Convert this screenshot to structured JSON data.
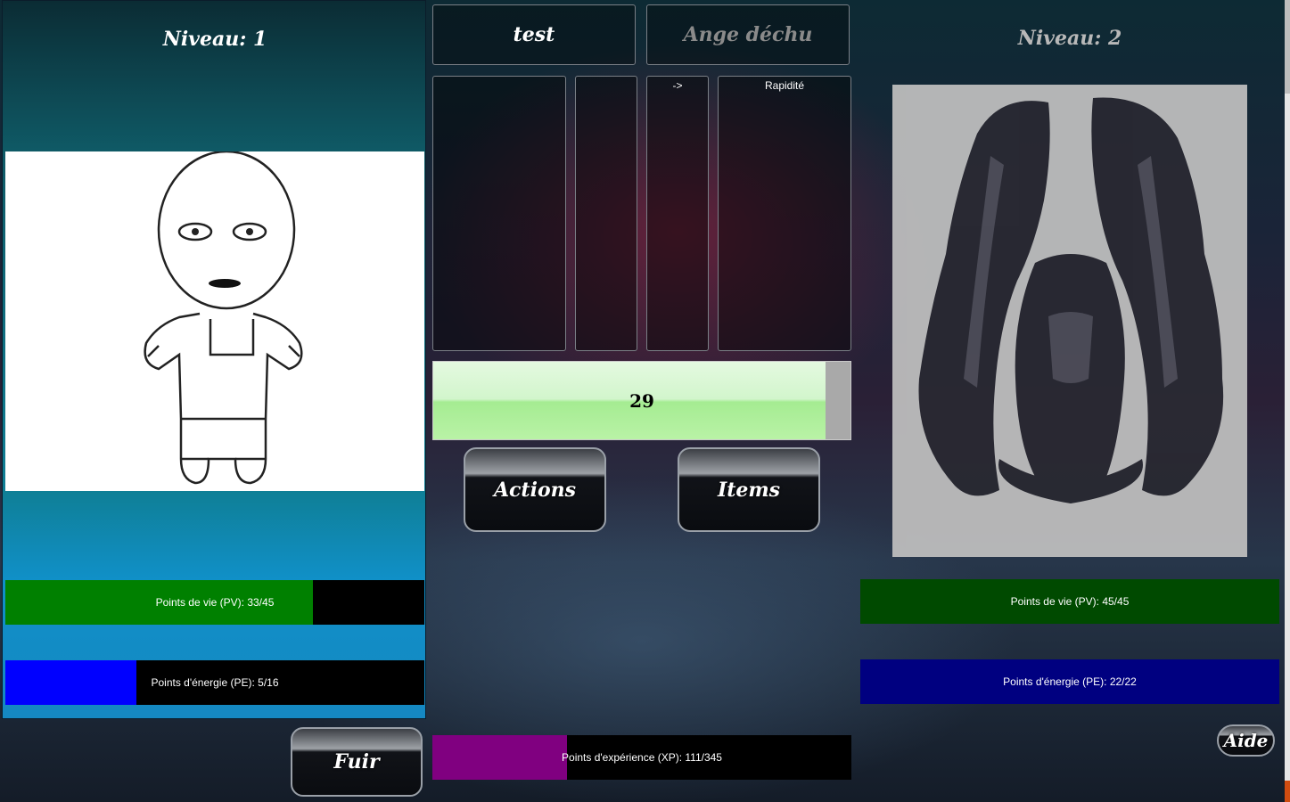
{
  "player": {
    "level_label": "Niveau: 1",
    "hp": {
      "label": "Points de vie (PV): 33/45",
      "current": 33,
      "max": 45,
      "color": "#008000"
    },
    "pe": {
      "label": "Points d'énergie (PE): 5/16",
      "current": 5,
      "max": 16,
      "color": "#0000ff"
    }
  },
  "center": {
    "player_name": "test",
    "enemy_name": "Ange déchu",
    "columns": [
      "",
      "",
      "->",
      "Rapidité"
    ],
    "turn_gauge": {
      "value": "29",
      "fill_fraction": 0.94
    },
    "buttons": {
      "actions": "Actions",
      "items": "Items",
      "flee": "Fuir"
    },
    "xp": {
      "label": "Points d'expérience (XP): 111/345",
      "current": 111,
      "max": 345,
      "color": "#800080"
    }
  },
  "enemy": {
    "level_label": "Niveau: 2",
    "hp": {
      "label": "Points de vie (PV): 45/45",
      "current": 45,
      "max": 45,
      "color": "#004a00"
    },
    "pe": {
      "label": "Points d'énergie (PE): 22/22",
      "current": 22,
      "max": 22,
      "color": "#000080"
    }
  },
  "help_button": "Aide"
}
